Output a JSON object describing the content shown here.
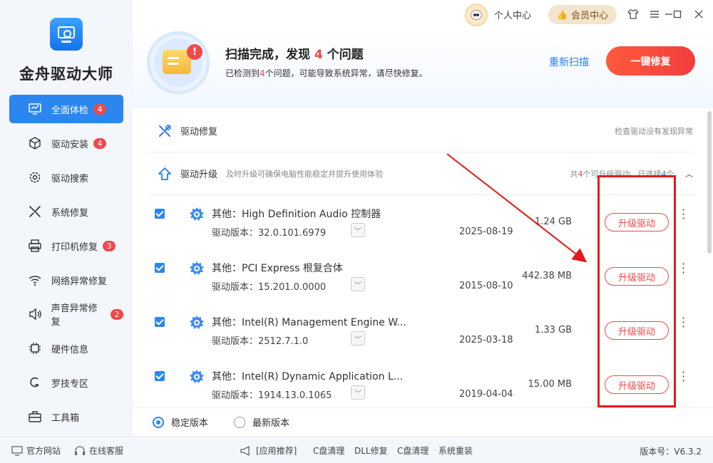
{
  "app": {
    "title": "金舟驱动大师"
  },
  "nav": [
    {
      "label": "全面体检",
      "badge": "4",
      "active": true,
      "icon": "monitor-icon"
    },
    {
      "label": "驱动安装",
      "badge": "4",
      "icon": "box-icon"
    },
    {
      "label": "驱动搜索",
      "badge": "",
      "icon": "gear-search-icon"
    },
    {
      "label": "系统修复",
      "badge": "",
      "icon": "tools-icon"
    },
    {
      "label": "打印机修复",
      "badge": "3",
      "icon": "printer-icon"
    },
    {
      "label": "网络异常修复",
      "badge": "",
      "icon": "wifi-icon"
    },
    {
      "label": "声音异常修复",
      "badge": "2",
      "icon": "speaker-icon"
    },
    {
      "label": "硬件信息",
      "badge": "",
      "icon": "chip-icon"
    },
    {
      "label": "罗技专区",
      "badge": "",
      "icon": "logitech-icon"
    },
    {
      "label": "工具箱",
      "badge": "",
      "icon": "toolbox-icon"
    }
  ],
  "topbar": {
    "user_center": "个人中心",
    "vip": "会员中心"
  },
  "banner": {
    "title_prefix": "扫描完成，发现 ",
    "title_count": "4",
    "title_suffix": " 个问题",
    "desc_prefix": "已检测到",
    "desc_count": "4",
    "desc_suffix": "个问题，可能导致系统异常，请尽快修复。",
    "rescan": "重新扫描",
    "fix_all": "一键修复"
  },
  "sections": {
    "repair": {
      "title": "驱动修复",
      "right": "检查驱动没有发现异常"
    },
    "upgrade": {
      "title": "驱动升级",
      "subtitle": "及时升级可确保电脑性能稳定并提升使用体验",
      "right_prefix": "共",
      "right_count": "4",
      "right_mid": "个可升级驱动，已选择",
      "right_selected": "4",
      "right_suffix": "个"
    }
  },
  "drivers": [
    {
      "name": "其他：High Definition Audio 控制器",
      "version": "驱动版本：32.0.101.6979",
      "date": "2025-08-19",
      "size": "1.24 GB",
      "action": "升级驱动"
    },
    {
      "name": "其他：PCI Express 根复合体",
      "version": "驱动版本：15.201.0.0000",
      "date": "2015-08-10",
      "size": "442.38 MB",
      "action": "升级驱动"
    },
    {
      "name": "其他：Intel(R) Management Engine W...",
      "version": "驱动版本：2512.7.1.0",
      "date": "2025-03-18",
      "size": "1.33 GB",
      "action": "升级驱动"
    },
    {
      "name": "其他：Intel(R) Dynamic Application L...",
      "version": "驱动版本：1914.13.0.1065",
      "date": "2019-04-04",
      "size": "15.00 MB",
      "action": "升级驱动"
    }
  ],
  "version_options": {
    "stable": "稳定版本",
    "latest": "最新版本"
  },
  "footer": {
    "site": "官方网站",
    "support": "在线客服",
    "rec": "[应用推荐]",
    "links": [
      "C盘清理",
      "DLL修复",
      "C盘清理",
      "系统重装"
    ],
    "version": "版本号：V6.3.2"
  },
  "colors": {
    "accent": "#2b86f0",
    "danger": "#f24848"
  }
}
